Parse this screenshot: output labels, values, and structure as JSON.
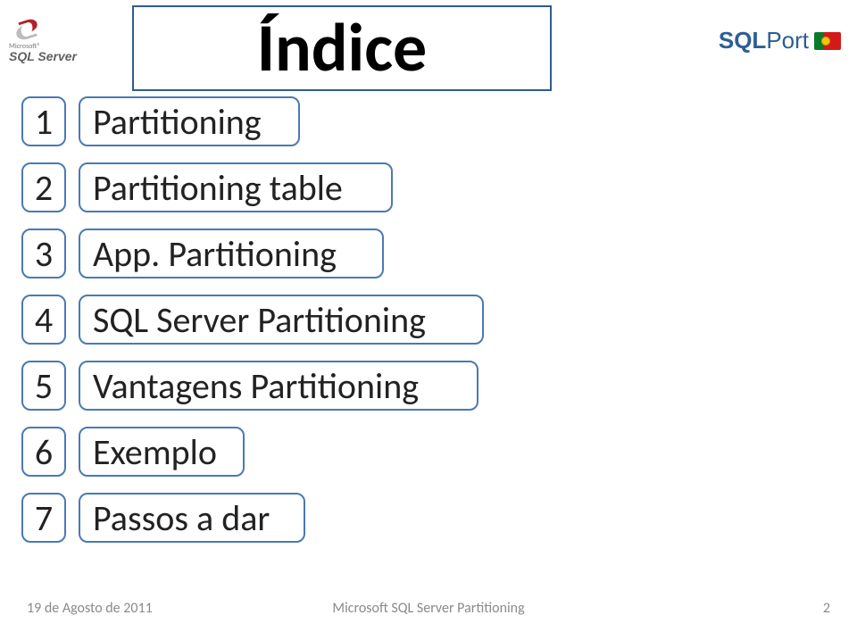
{
  "header": {
    "title": "Índice",
    "logoLeft": {
      "microsoft": "Microsoft®",
      "product": "SQL Server"
    },
    "logoRight": {
      "sql": "SQL",
      "port": "Port"
    }
  },
  "index": {
    "items": [
      {
        "num": "1",
        "label": "Partitioning"
      },
      {
        "num": "2",
        "label": "Partitioning table"
      },
      {
        "num": "3",
        "label": "App. Partitioning"
      },
      {
        "num": "4",
        "label": "SQL Server Partitioning"
      },
      {
        "num": "5",
        "label": "Vantagens Partitioning"
      },
      {
        "num": "6",
        "label": "Exemplo"
      },
      {
        "num": "7",
        "label": "Passos a dar"
      }
    ]
  },
  "footer": {
    "date": "19 de Agosto de 2011",
    "title": "Microsoft SQL Server Partitioning",
    "page": "2"
  }
}
